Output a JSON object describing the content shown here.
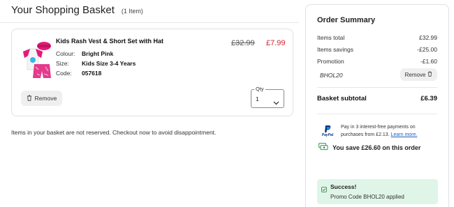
{
  "page": {
    "title": "Your Shopping Basket",
    "item_count": "(1 Item)"
  },
  "basket": {
    "item": {
      "name": "Kids Rash Vest & Short Set with Hat",
      "colour_label": "Colour:",
      "colour": "Bright Pink",
      "size_label": "Size:",
      "size": "Kids Size 3-4 Years",
      "code_label": "Code:",
      "code": "057618",
      "price_was": "£32.99",
      "price_now": "£7.99",
      "remove_label": "Remove",
      "qty_label": "Qty",
      "qty_value": "1"
    },
    "reserve_note": "Items in your basket are not reserved. Checkout now to avoid disappointment."
  },
  "summary": {
    "title": "Order Summary",
    "items_total_label": "Items total",
    "items_total": "£32.99",
    "savings_label": "Items savings",
    "savings": "-£25.00",
    "promotion_label": "Promotion",
    "promotion": "-£1.60",
    "promo_code": "BHOL20",
    "promo_remove_label": "Remove",
    "subtotal_label": "Basket subtotal",
    "subtotal": "£6.39",
    "paypal": {
      "logo": "PayPal",
      "text": "Pay in 3 interest-free payments on purchases from £2.13.",
      "link": "Learn more."
    },
    "saving_message": "You save £26.60 on this order",
    "success": {
      "title": "Success!",
      "message": "Promo Code BHOL20 applied"
    }
  },
  "icons": {
    "remove": "trash-icon",
    "qty": "chevron-down-icon",
    "paypal": "paypal-icon",
    "save": "cash-icon",
    "success": "check-icon"
  },
  "colors": {
    "sale_price": "#d2232a",
    "success_bg": "#dff5e8",
    "link": "#1a5fbf",
    "accent_pink": "#e6197a"
  }
}
